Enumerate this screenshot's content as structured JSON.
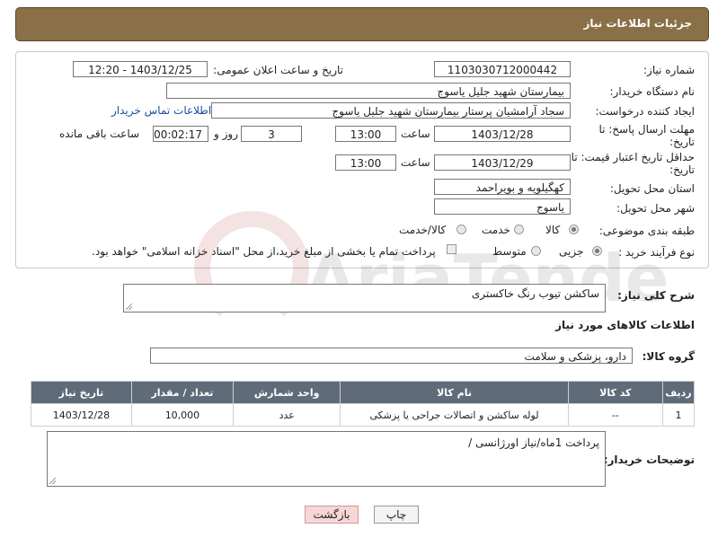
{
  "header": {
    "title": "جزئیات اطلاعات نیاز"
  },
  "form": {
    "need_number_label": "شماره نیاز:",
    "need_number": "1103030712000442",
    "announce_label": "تاریخ و ساعت اعلان عمومی:",
    "announce_value": "1403/12/25 - 12:20",
    "buyer_org_label": "نام دستگاه خریدار:",
    "buyer_org": "بیمارستان شهید جلیل یاسوج",
    "creator_label": "ایجاد کننده درخواست:",
    "creator": "سجاد آرامشیان پرستار بیمارستان شهید جلیل یاسوج",
    "contact_link": "اطلاعات تماس خریدار",
    "deadline_label_1": "مهلت ارسال پاسخ: تا",
    "deadline_label_2": "تاریخ:",
    "deadline_date": "1403/12/28",
    "time_label": "ساعت",
    "deadline_time": "13:00",
    "days_value": "3",
    "days_label": "روز و",
    "remaining_value": "00:02:17",
    "remaining_label": "ساعت باقی مانده",
    "validity_label_1": "حداقل تاریخ اعتبار قیمت: تا",
    "validity_label_2": "تاریخ:",
    "validity_date": "1403/12/29",
    "validity_time_label": "ساعت",
    "validity_time": "13:00",
    "province_label": "استان محل تحویل:",
    "province": "کهگیلویه و بویراحمد",
    "city_label": "شهر محل تحویل:",
    "city": "یاسوج",
    "category_label": "طبقه بندی موضوعی:",
    "category_options": [
      "کالا",
      "خدمت",
      "کالا/خدمت"
    ],
    "category_selected": "کالا",
    "process_label": "نوع فرآیند خرید :",
    "process_options": [
      "جزیی",
      "متوسط"
    ],
    "process_selected": "جزیی",
    "payment_note": "پرداخت تمام یا بخشی از مبلغ خرید،از محل \"اسناد خزانه اسلامی\" خواهد بود."
  },
  "summary": {
    "label": "شرح کلی نیاز:",
    "value": "ساکشن تیوب رنگ خاکستری"
  },
  "goods_section": {
    "title": "اطلاعات کالاهای مورد نیاز",
    "group_label": "گروه کالا:",
    "group_value": "دارو، پزشکی و سلامت"
  },
  "table": {
    "headers": [
      "ردیف",
      "کد کالا",
      "نام کالا",
      "واحد شمارش",
      "تعداد / مقدار",
      "تاریخ نیاز"
    ],
    "rows": [
      [
        "1",
        "--",
        "لوله ساکشن و اتصالات جراحی یا پزشکی",
        "عدد",
        "10,000",
        "1403/12/28"
      ]
    ]
  },
  "buyer_notes": {
    "label": "توضیحات خریدار:",
    "value": "پرداخت 1ماه/نیاز اورژانسی /"
  },
  "buttons": {
    "print": "چاپ",
    "back": "بازگشت"
  },
  "watermark_text": "AriaTender.net",
  "colors": {
    "header_bg": "#8a7047",
    "table_header_bg": "#5f6b78",
    "back_button_bg": "#f7d6d6",
    "link": "#1a4f9c"
  }
}
